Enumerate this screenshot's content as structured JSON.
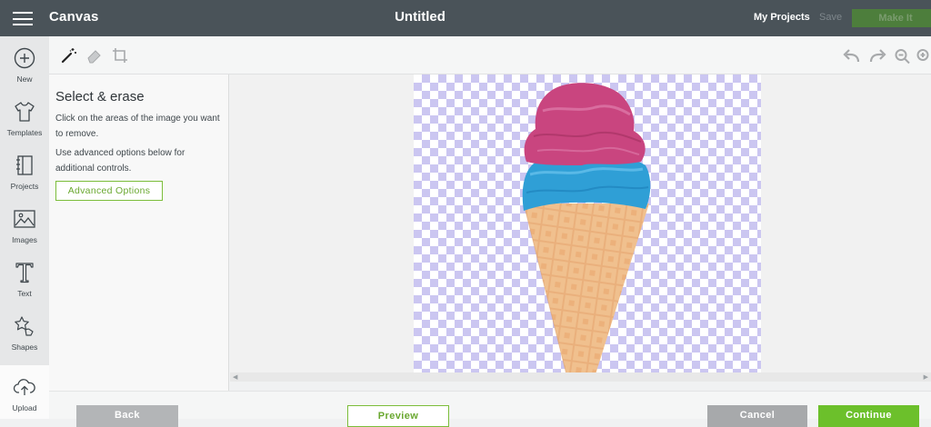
{
  "topbar": {
    "app_name": "Canvas",
    "document_title": "Untitled",
    "my_projects": "My Projects",
    "save": "Save",
    "make_it": "Make It"
  },
  "leftnav": {
    "items": [
      {
        "label": "New",
        "icon": "plus-circle-icon"
      },
      {
        "label": "Templates",
        "icon": "shirt-icon"
      },
      {
        "label": "Projects",
        "icon": "notebook-icon"
      },
      {
        "label": "Images",
        "icon": "image-icon"
      },
      {
        "label": "Text",
        "icon": "text-t-icon"
      },
      {
        "label": "Shapes",
        "icon": "shapes-icon"
      },
      {
        "label": "Upload",
        "icon": "cloud-upload-icon"
      }
    ]
  },
  "toolbar": {
    "tools": [
      "magic-wand-icon",
      "eraser-icon",
      "crop-icon"
    ],
    "right_tools": [
      "undo-icon",
      "redo-icon",
      "zoom-out-icon",
      "zoom-in-icon"
    ]
  },
  "panel": {
    "title": "Select & erase",
    "instruction": "Click on the areas of the image you want to remove.",
    "advanced_hint": "Use advanced options below for additional controls.",
    "advanced_button": "Advanced Options"
  },
  "canvas": {
    "image_subject": "ice-cream-cone-image"
  },
  "bottombar": {
    "back": "Back",
    "preview": "Preview",
    "cancel": "Cancel",
    "continue": "Continue"
  },
  "colors": {
    "topbar_bg": "#4a5359",
    "accent_green": "#6cc02b",
    "checker": "#cbc6f1"
  }
}
